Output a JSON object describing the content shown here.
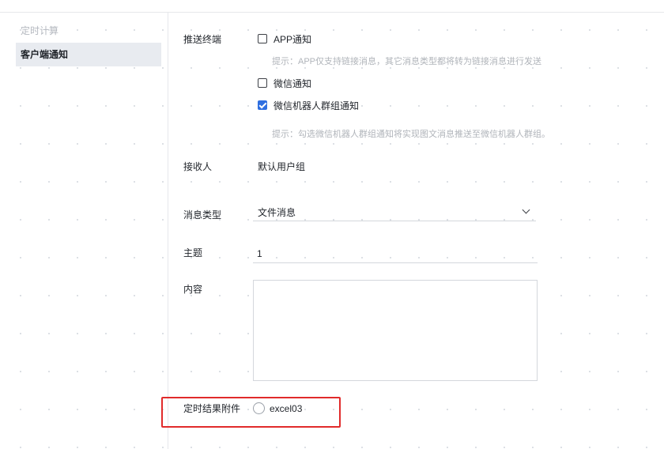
{
  "sidebar": {
    "items": [
      {
        "label": "定时计算",
        "state": "inactive"
      },
      {
        "label": "客户端通知",
        "state": "active"
      }
    ]
  },
  "form": {
    "push_terminal": {
      "label": "推送终端",
      "options": [
        {
          "label": "APP通知",
          "checked": false
        },
        {
          "label": "微信通知",
          "checked": false
        },
        {
          "label": "微信机器人群组通知",
          "checked": true
        }
      ],
      "app_hint": "提示：APP仅支持链接消息，其它消息类型都将转为链接消息进行发送",
      "robot_hint": "提示：勾选微信机器人群组通知将实现图文消息推送至微信机器人群组。"
    },
    "receiver": {
      "label": "接收人",
      "value": "默认用户组"
    },
    "message_type": {
      "label": "消息类型",
      "selected": "文件消息"
    },
    "subject": {
      "label": "主题",
      "value": "1"
    },
    "content": {
      "label": "内容",
      "value": ""
    },
    "attachment": {
      "label": "定时结果附件",
      "option": "excel03",
      "selected": false
    }
  },
  "colors": {
    "accent": "#2f6fe0",
    "highlight": "#e12b2b",
    "hint_text": "#b0b4ba"
  }
}
